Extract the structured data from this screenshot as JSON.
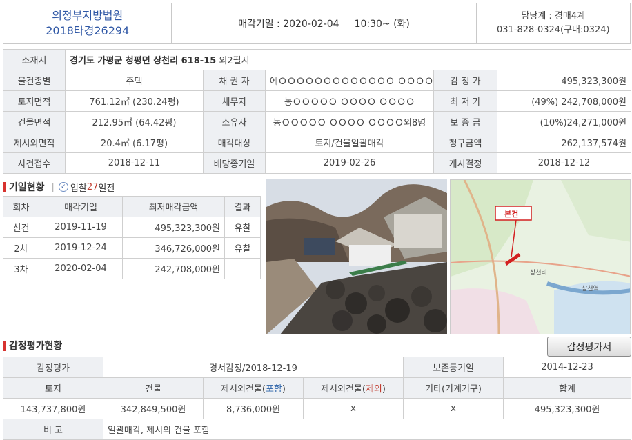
{
  "header": {
    "court": "의정부지방법원",
    "case_no": "2018타경26294",
    "auction_label": "매각기일 : 2020-02-04",
    "auction_time": "10:30~ (화)",
    "dept": "담당계 : 경매4계",
    "phone": "031-828-0324(구내:0324)"
  },
  "property": {
    "location_label": "소재지",
    "location_value": "경기도 가평군 청평면 상천리 618-15",
    "location_suffix": "외2필지",
    "rows": [
      {
        "l1": "물건종별",
        "v1": "주택",
        "l2": "채 권 자",
        "v2": "에ＯＯＯＯＯＯＯＯＯＯＯＯＯ ＯＯＯＯ",
        "l3": "감 정 가",
        "v3": "495,323,300원"
      },
      {
        "l1": "토지면적",
        "v1": "761.12㎡ (230.24평)",
        "l2": "채무자",
        "v2": "농ＯＯＯＯＯ ＯＯＯＯ ＯＯＯＯ",
        "l3": "최 저 가",
        "v3": "(49%) 242,708,000원"
      },
      {
        "l1": "건물면적",
        "v1": "212.95㎡ (64.42평)",
        "l2": "소유자",
        "v2": "농ＯＯＯＯＯ ＯＯＯＯ ＯＯＯＯ외8명",
        "l3": "보 증 금",
        "v3": "(10%)24,271,000원"
      },
      {
        "l1": "제시외면적",
        "v1": "20.4㎡ (6.17평)",
        "l2": "매각대상",
        "v2": "토지/건물일괄매각",
        "l3": "청구금액",
        "v3": "262,137,574원"
      },
      {
        "l1": "사건접수",
        "v1": "2018-12-11",
        "l2": "배당종기일",
        "v2": "2019-02-26",
        "l3": "개시결정",
        "v3": "2018-12-12"
      }
    ]
  },
  "history": {
    "title": "기일현황",
    "bid_prefix": "입찰",
    "bid_days": "27",
    "bid_suffix": "일전",
    "headers": [
      "회차",
      "매각기일",
      "최저매각금액",
      "결과"
    ],
    "rows": [
      {
        "round": "신건",
        "date": "2019-11-19",
        "price": "495,323,300원",
        "result": "유찰"
      },
      {
        "round": "2차",
        "date": "2019-12-24",
        "price": "346,726,000원",
        "result": "유찰"
      },
      {
        "round": "3차",
        "date": "2020-02-04",
        "price": "242,708,000원",
        "result": ""
      }
    ]
  },
  "map": {
    "pin_label": "본건",
    "place1": "상천리",
    "place2": "상천역"
  },
  "appraisal": {
    "title": "감정평가현황",
    "button": "감정평가서",
    "row1": {
      "label": "감정평가",
      "value": "경서감정/2018-12-19",
      "label2": "보존등기일",
      "value2": "2014-12-23"
    },
    "headers": {
      "land": "토지",
      "building": "건물",
      "extra_in_pre": "제시외건물(",
      "extra_in_mark": "포함",
      "extra_out_pre": "제시외건물(",
      "extra_out_mark": "제외",
      "close": ")",
      "other": "기타(기계기구)",
      "total": "합계"
    },
    "values": {
      "land": "143,737,800원",
      "building": "342,849,500원",
      "extra_in": "8,736,000원",
      "extra_out": "x",
      "other": "x",
      "total": "495,323,300원"
    },
    "note_label": "비 고",
    "note_value": "일괄매각, 제시외 건물 포함"
  },
  "colors": {
    "accent_red": "#d7322f",
    "link_blue": "#2f57a5",
    "label_bg": "#eef0f3"
  }
}
